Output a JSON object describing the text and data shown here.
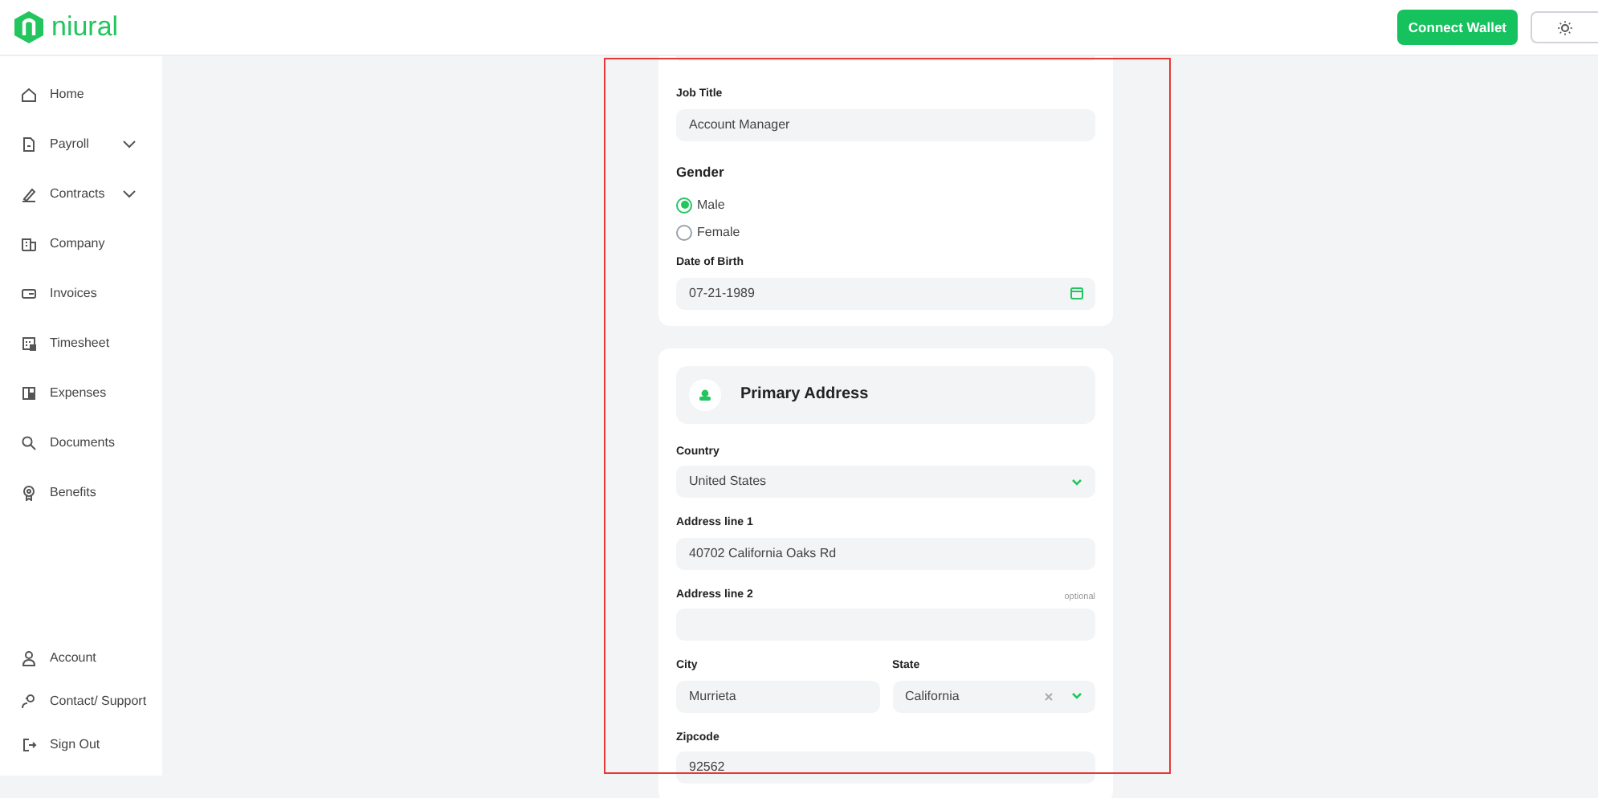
{
  "brand": {
    "name": "niural"
  },
  "header": {
    "connect_button": "Connect Wallet"
  },
  "sidebar": {
    "items": [
      {
        "label": "Home",
        "expandable": false
      },
      {
        "label": "Payroll",
        "expandable": true
      },
      {
        "label": "Contracts",
        "expandable": true
      },
      {
        "label": "Company",
        "expandable": false
      },
      {
        "label": "Invoices",
        "expandable": false
      },
      {
        "label": "Timesheet",
        "expandable": false
      },
      {
        "label": "Expenses",
        "expandable": false
      },
      {
        "label": "Documents",
        "expandable": false
      },
      {
        "label": "Benefits",
        "expandable": false
      }
    ],
    "bottom_items": [
      {
        "label": "Account"
      },
      {
        "label": "Contact/ Support"
      },
      {
        "label": "Sign Out"
      }
    ]
  },
  "highlight_frame": true,
  "personal": {
    "job_title": {
      "label": "Job Title",
      "value": "Account Manager"
    },
    "gender": {
      "label": "Gender",
      "options": [
        {
          "label": "Male",
          "selected": true
        },
        {
          "label": "Female",
          "selected": false
        }
      ]
    },
    "date_of_birth": {
      "label": "Date of Birth",
      "value": "07-21-1989"
    }
  },
  "primary_address": {
    "title": "Primary Address",
    "rows": [
      [
        {
          "label": "Country",
          "value": "United States",
          "kind": "select"
        }
      ],
      [
        {
          "label": "Address line 1",
          "value": "40702 California Oaks Rd",
          "kind": "text"
        }
      ],
      [
        {
          "label": "Address line 2",
          "note": "optional",
          "kind": "text"
        }
      ],
      [
        {
          "label": "City",
          "value": "Murrieta",
          "kind": "text"
        },
        {
          "label": "State",
          "value": "California",
          "kind": "select",
          "clearable": true
        }
      ],
      [
        {
          "label": "Zipcode",
          "value": "92562",
          "kind": "text"
        }
      ]
    ]
  }
}
